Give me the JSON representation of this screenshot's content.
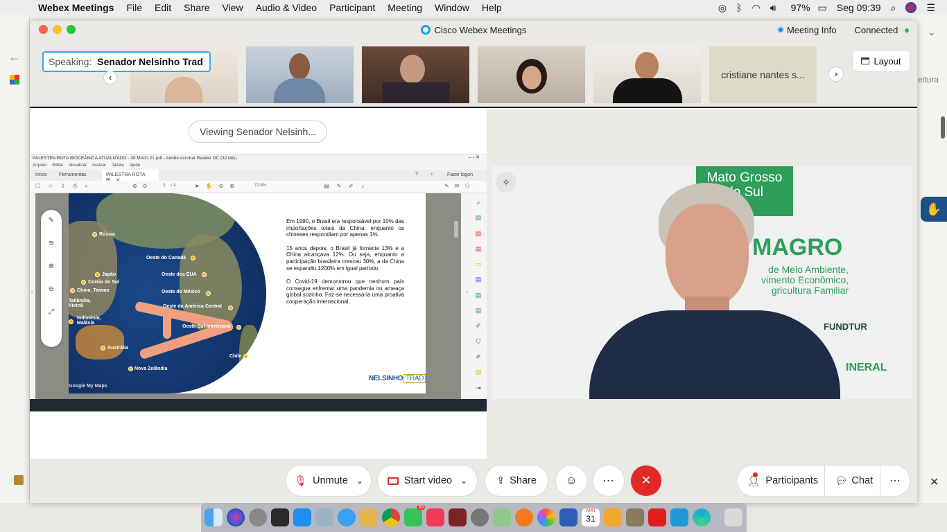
{
  "menubar": {
    "app": "Webex Meetings",
    "items": [
      "File",
      "Edit",
      "Share",
      "View",
      "Audio & Video",
      "Participant",
      "Meeting",
      "Window",
      "Help"
    ],
    "battery": "97%",
    "clock": "Seg 09:39"
  },
  "background": {
    "right_text": "eitura"
  },
  "window": {
    "title": "Cisco Webex Meetings",
    "meeting_info": "Meeting Info",
    "connected": "Connected",
    "speaking_label": "Speaking:",
    "speaking_name": "Senador Nelsinho Trad",
    "participant_name_tile": "cristiane nantes s...",
    "layout_button": "Layout",
    "viewing_label": "Viewing Senador Nelsinh..."
  },
  "pdf": {
    "window_title": "PALESTRA ROTA BIOCEÂNICA ATUALIZADO - 30 MAIO 21.pdf - Adobe Acrobat Reader DC (32 bits)",
    "menu": [
      "Arquivo",
      "Editar",
      "Visualizar",
      "Assinar",
      "Janela",
      "Ajuda"
    ],
    "tabs": [
      "Início",
      "Ferramentas",
      "PALESTRA ROTA BI..."
    ],
    "login": "Fazer logon",
    "page_current": "3",
    "page_total": "/ 4",
    "zoom": "72,8%",
    "map_labels": [
      "Rússia",
      "Oeste do Canadá",
      "Japão",
      "Coréia do Sul",
      "China, Taiwan",
      "Oeste dos EUA",
      "Oeste do México",
      "Tailândia, Vietnã",
      "Oeste da América Central",
      "Indonésia, Malásia",
      "Oeste Sul-americana",
      "Austrália",
      "Chile",
      "Nova Zelândia",
      "Google My Maps"
    ],
    "paragraphs": [
      "Em 1990, o Brasil era responsável por 10% das importações totais da China, enquanto os chineses respondiam por apenas 1%.",
      "15 anos depois, o Brasil já fornecia 13% e a China alcançava 12%. Ou seja, enquanto a participação brasileira cresceu 30%, a da China se expandiu 1200% em igual período.",
      "O Covid-19 demonstrou que nenhum país consegue enfrentar uma pandemia ou ameaça global sozinho. Faz-se necessária uma proativa cooperação internacional."
    ],
    "logo_left": "NELSINHO",
    "logo_right": "TRAD"
  },
  "video": {
    "banner_line1": "Mato Grosso",
    "banner_line2": "do Sul",
    "wall_big": "MAGRO",
    "wall_lines": [
      "de Meio Ambiente,",
      "vimento Econômico,",
      "gricultura Familiar"
    ],
    "wall_logo": "FUNDTUR",
    "wall_bottom": "INERAL"
  },
  "controls": {
    "unmute": "Unmute",
    "start_video": "Start video",
    "share": "Share",
    "participants": "Participants",
    "chat": "Chat"
  },
  "dock": {
    "calendar_month": "MAI",
    "calendar_day": "31",
    "badge": "35"
  }
}
